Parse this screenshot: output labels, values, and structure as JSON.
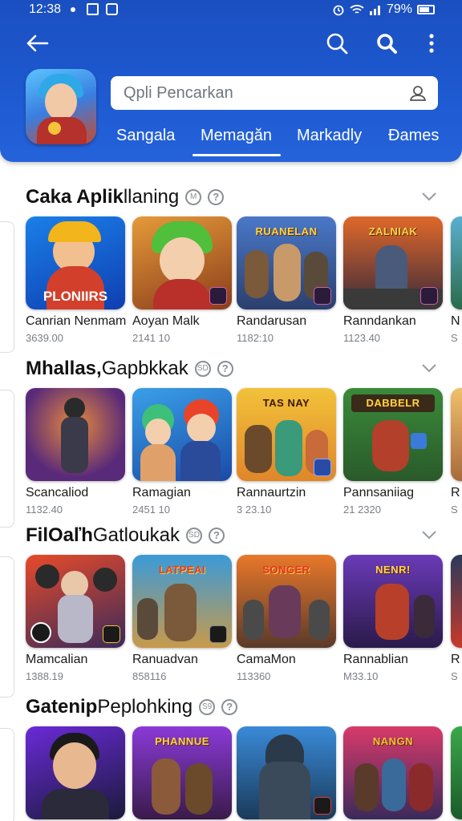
{
  "status_bar": {
    "time": "12:38",
    "battery": "79%"
  },
  "header": {
    "search_placeholder": "Qpli Pencarkan",
    "tabs": [
      {
        "label": "Sangala"
      },
      {
        "label": "Memagăn"
      },
      {
        "label": "Markadly"
      },
      {
        "label": "Ðames"
      }
    ],
    "active_tab_index": 1
  },
  "sections": [
    {
      "title_bold": "Caka Aplik",
      "title_rest": " llaning",
      "badge": "M",
      "cards": [
        {
          "name": "Canrian Nenmam",
          "meta": "3639.00",
          "logo": "PLONIIRS"
        },
        {
          "name": "Aoyan Malk",
          "meta": "2141 10"
        },
        {
          "name": "Randarusan",
          "meta": "1182:10",
          "logo": "RUANELAN"
        },
        {
          "name": "Ranndankan",
          "meta": "1123.40",
          "logo": "ZALNIAK"
        },
        {
          "name": "N",
          "meta": "S"
        }
      ]
    },
    {
      "title_bold": "Mhallas,",
      "title_rest": " Gapbkkak",
      "badge": "SD",
      "cards": [
        {
          "name": "Scancaliod",
          "meta": "1132.40"
        },
        {
          "name": "Ramagian",
          "meta": "2451 10"
        },
        {
          "name": "Rannaurtzin",
          "meta": "3 23.10",
          "logo": "TAS NAY"
        },
        {
          "name": "Pannsaniiag",
          "meta": "21 2320",
          "logo": "DABBELR"
        },
        {
          "name": "R",
          "meta": "S"
        }
      ]
    },
    {
      "title_bold": "FilOaľh",
      "title_rest": " Gatloukak",
      "badge": "SD",
      "cards": [
        {
          "name": "Mamcalian",
          "meta": "1388.19"
        },
        {
          "name": "Ranuadvan",
          "meta": "858116",
          "logo": "LATPEAI"
        },
        {
          "name": "CamaMon",
          "meta": "113360",
          "logo": "SONGER"
        },
        {
          "name": "Rannablian",
          "meta": "M33.10",
          "logo": "NENR!"
        },
        {
          "name": "R",
          "meta": "S"
        }
      ]
    },
    {
      "title_bold": "Gatenip",
      "title_rest": " Peplohking",
      "badge": "S9",
      "cards": [
        {
          "name": "",
          "meta": ""
        },
        {
          "name": "",
          "meta": "",
          "logo": "PHANNUE"
        },
        {
          "name": "",
          "meta": ""
        },
        {
          "name": "",
          "meta": "",
          "logo": "NANGN"
        },
        {
          "name": "",
          "meta": ""
        }
      ]
    }
  ],
  "colors": {
    "header_blue": "#1e5ad2",
    "tab_indicator": "#ffffff",
    "title_text": "#111111",
    "meta_text": "#7a7f86"
  },
  "icons": [
    "back-arrow-icon",
    "search-icon",
    "search-bold-icon",
    "more-vert-icon",
    "user-icon",
    "chevron-down-icon",
    "help-icon"
  ]
}
